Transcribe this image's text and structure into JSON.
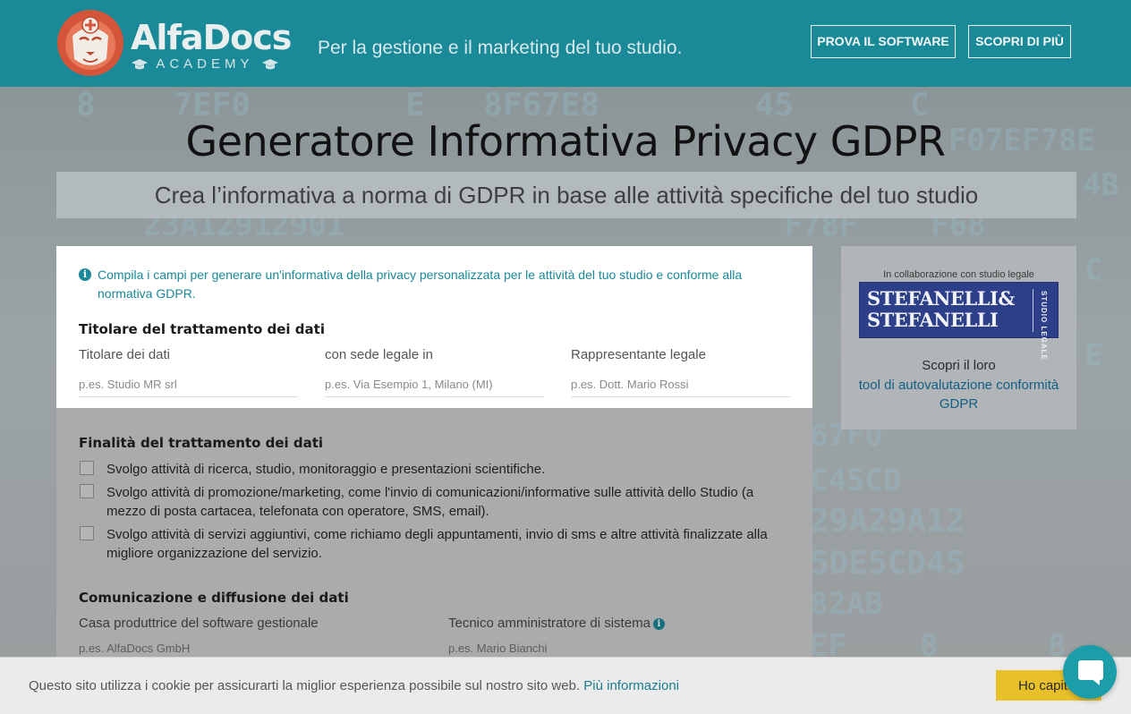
{
  "header": {
    "brand": "AlfaDocs",
    "brand_sub": "ACADEMY",
    "tagline": "Per la gestione e il marketing del tuo studio.",
    "btn_try": "PROVA IL SOFTWARE",
    "btn_discover": "SCOPRI DI PIÙ",
    "brand_color": "#1a8a99"
  },
  "hero": {
    "title": "Generatore Informativa Privacy GDPR",
    "subtitle": "Crea l’informativa a norma di GDPR in base alle attività specifiche del tuo studio"
  },
  "form": {
    "info": "Compila i campi per generare un'informativa della privacy personalizzata per le attività del tuo studio e conforme alla normativa GDPR.",
    "section_owner": {
      "title": "Titolare del trattamento dei dati",
      "fields": [
        {
          "label": "Titolare dei dati",
          "value": "",
          "placeholder": "p.es. Studio MR srl"
        },
        {
          "label": "con sede legale in",
          "value": "",
          "placeholder": "p.es. Via Esempio 1, Milano (MI)"
        },
        {
          "label": "Rappresentante legale",
          "value": "",
          "placeholder": "p.es. Dott. Mario Rossi"
        }
      ]
    },
    "section_purpose": {
      "title": "Finalità del trattamento dei dati",
      "options": [
        {
          "label": "Svolgo attività di ricerca, studio, monitoraggio e presentazioni scientifiche.",
          "checked": false
        },
        {
          "label": "Svolgo attività di promozione/marketing, come l'invio di comunicazioni/informative sulle attività dello Studio (a mezzo di posta cartacea, telefonata con operatore, SMS, email).",
          "checked": false
        },
        {
          "label": "Svolgo attività di servizi aggiuntivi, come richiamo degli appuntamenti, invio di sms e altre attività finalizzate alla migliore organizzazione del servizio.",
          "checked": false
        }
      ]
    },
    "section_comm": {
      "title": "Comunicazione e diffusione dei dati",
      "fields": [
        {
          "label": "Casa produttrice del software gestionale",
          "value": "",
          "placeholder": "p.es. AlfaDocs GmbH"
        },
        {
          "label": "Tecnico amministratore di sistema",
          "value": "",
          "placeholder": "p.es. Mario Bianchi"
        }
      ]
    }
  },
  "partner": {
    "caption": "In collaborazione con studio legale",
    "logo_line1": "STEFANELLI&",
    "logo_line2": "STEFANELLI",
    "logo_side": "STUDIO LEGALE",
    "desc": "Scopri il loro",
    "link": "tool di autovalutazione conformità GDPR",
    "logo_color": "#2e3f8a"
  },
  "cookie": {
    "text": "Questo sito utilizza i cookie per assicurarti la miglior esperienza possibile sul nostro sito web.",
    "link": "Più informazioni",
    "button": "Ho capito",
    "button_color": "#e8c02a"
  },
  "chat": {
    "icon": "chat-bubble-icon",
    "color": "#1b9eaa"
  }
}
